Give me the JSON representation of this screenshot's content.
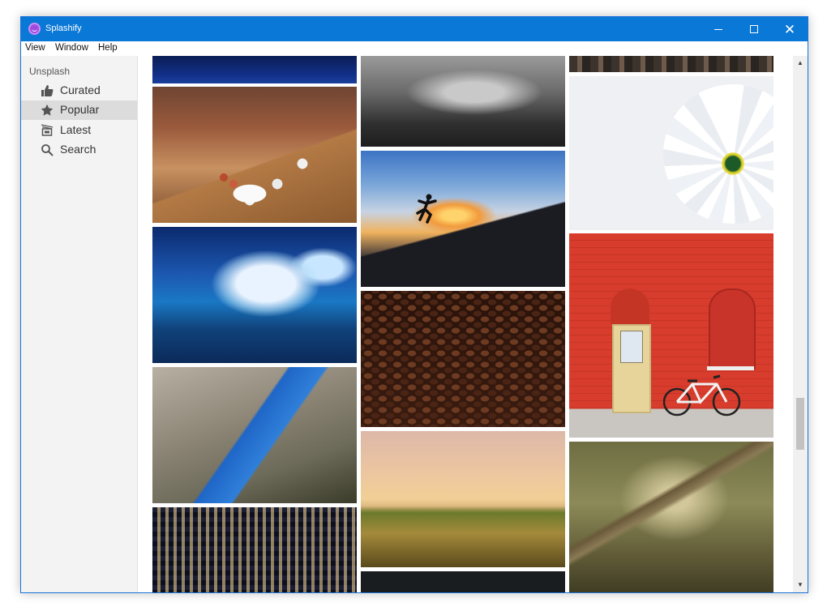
{
  "window": {
    "title": "Splashify"
  },
  "menu": [
    "View",
    "Window",
    "Help"
  ],
  "sidebar": {
    "heading": "Unsplash",
    "items": [
      {
        "label": "Curated",
        "icon": "thumbs-up-icon"
      },
      {
        "label": "Popular",
        "icon": "star-icon",
        "active": true
      },
      {
        "label": "Latest",
        "icon": "latest-icon"
      },
      {
        "label": "Search",
        "icon": "search-icon"
      }
    ]
  },
  "colors": {
    "titlebar": "#0a78d7",
    "sidebar": "#f3f3f3",
    "active": "#dcdcdc",
    "app_icon": "#a04be0"
  },
  "photos": [
    "night-blue-sky",
    "cafe-table-coffee-cups",
    "ocean-wave-surfer",
    "fjord-cliffs",
    "office-building-night",
    "misty-forest-bw",
    "sunset-jumping-person",
    "coffee-beans",
    "hot-air-balloons",
    "dark-photo",
    "city-street-top",
    "white-daisy",
    "red-brick-wall-bicycle",
    "sunlit-forest"
  ]
}
